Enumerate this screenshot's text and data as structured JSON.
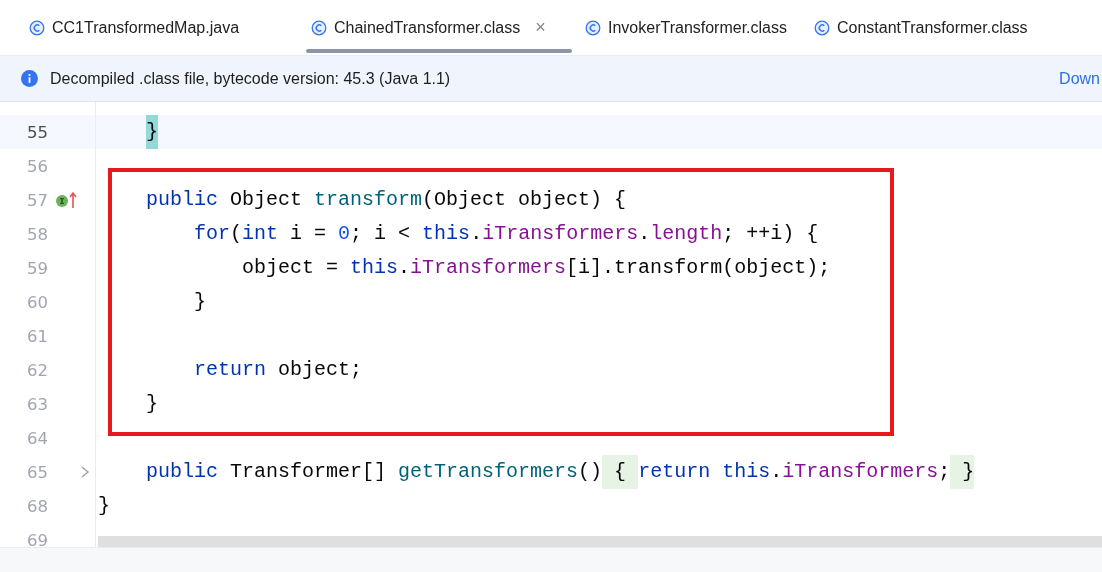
{
  "tabs": [
    {
      "label": "CC1TransformedMap.java",
      "selected": false,
      "closable": false
    },
    {
      "label": "ChainedTransformer.class",
      "selected": true,
      "closable": true
    },
    {
      "label": "InvokerTransformer.class",
      "selected": false,
      "closable": false
    },
    {
      "label": "ConstantTransformer.class",
      "selected": false,
      "closable": false
    }
  ],
  "close_glyph": "×",
  "banner": {
    "text": "Decompiled .class file, bytecode version: 45.3 (Java 1.1)",
    "link": "Down"
  },
  "editor": {
    "lines": [
      {
        "number": "55",
        "current": true,
        "override_marker": false,
        "foldable": false,
        "tokens": [
          {
            "text": "    }",
            "kind": "brace-match"
          }
        ]
      },
      {
        "number": "56",
        "current": false,
        "override_marker": false,
        "foldable": false
      },
      {
        "number": "57",
        "current": false,
        "override_marker": true,
        "foldable": false,
        "tokens": [
          {
            "text": "    public",
            "kind": "keyword"
          },
          {
            "text": " Object ",
            "kind": "plain"
          },
          {
            "text": "transform",
            "kind": "method"
          },
          {
            "text": "(Object object) {",
            "kind": "plain"
          }
        ]
      },
      {
        "number": "58",
        "current": false,
        "override_marker": false,
        "foldable": false,
        "tokens": [
          {
            "text": "        for",
            "kind": "keyword"
          },
          {
            "text": "(",
            "kind": "plain"
          },
          {
            "text": "int",
            "kind": "keyword"
          },
          {
            "text": " i = ",
            "kind": "plain"
          },
          {
            "text": "0",
            "kind": "number"
          },
          {
            "text": "; i < ",
            "kind": "plain"
          },
          {
            "text": "this",
            "kind": "keyword"
          },
          {
            "text": ".",
            "kind": "plain"
          },
          {
            "text": "iTransformers",
            "kind": "field"
          },
          {
            "text": ".",
            "kind": "plain"
          },
          {
            "text": "length",
            "kind": "field"
          },
          {
            "text": "; ++i) {",
            "kind": "plain"
          }
        ]
      },
      {
        "number": "59",
        "current": false,
        "override_marker": false,
        "foldable": false,
        "tokens": [
          {
            "text": "            object = ",
            "kind": "plain"
          },
          {
            "text": "this",
            "kind": "keyword"
          },
          {
            "text": ".",
            "kind": "plain"
          },
          {
            "text": "iTransformers",
            "kind": "field"
          },
          {
            "text": "[i].transform(object);",
            "kind": "plain"
          }
        ]
      },
      {
        "number": "60",
        "current": false,
        "override_marker": false,
        "foldable": false,
        "tokens": [
          {
            "text": "        }",
            "kind": "plain"
          }
        ]
      },
      {
        "number": "61",
        "current": false,
        "override_marker": false,
        "foldable": false
      },
      {
        "number": "62",
        "current": false,
        "override_marker": false,
        "foldable": false,
        "tokens": [
          {
            "text": "        return",
            "kind": "keyword"
          },
          {
            "text": " object;",
            "kind": "plain"
          }
        ]
      },
      {
        "number": "63",
        "current": false,
        "override_marker": false,
        "foldable": false,
        "tokens": [
          {
            "text": "    }",
            "kind": "plain"
          }
        ]
      },
      {
        "number": "64",
        "current": false,
        "override_marker": false,
        "foldable": false
      },
      {
        "number": "65",
        "current": false,
        "override_marker": false,
        "foldable": true,
        "tokens": [
          {
            "text": "    public",
            "kind": "keyword"
          },
          {
            "text": " Transformer[] ",
            "kind": "plain"
          },
          {
            "text": "getTransformers",
            "kind": "method"
          },
          {
            "text": "()",
            "kind": "plain"
          },
          {
            "text": " { ",
            "kind": "fold"
          },
          {
            "text": "return ",
            "kind": "keyword"
          },
          {
            "text": "this",
            "kind": "keyword"
          },
          {
            "text": ".",
            "kind": "plain"
          },
          {
            "text": "iTransformers",
            "kind": "field"
          },
          {
            "text": ";",
            "kind": "plain"
          },
          {
            "text": " }",
            "kind": "fold"
          }
        ]
      },
      {
        "number": "68",
        "current": false,
        "override_marker": false,
        "foldable": false,
        "tokens": [
          {
            "text": "}",
            "kind": "plain"
          }
        ]
      },
      {
        "number": "69",
        "current": false,
        "override_marker": false,
        "foldable": false
      }
    ]
  }
}
